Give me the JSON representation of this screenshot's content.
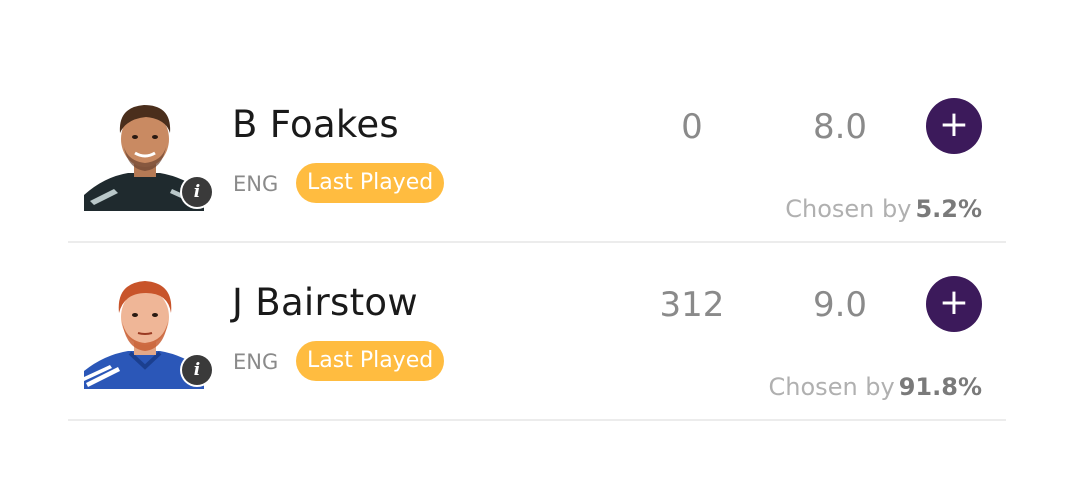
{
  "players": [
    {
      "name": "B Foakes",
      "team": "ENG",
      "badge": "Last Played",
      "points": "0",
      "credits": "8.0",
      "add_label": "+",
      "chosen_label": "Chosen by",
      "chosen_pct": "5.2%",
      "info_label": "i",
      "avatar": "player-headshot"
    },
    {
      "name": "J Bairstow",
      "team": "ENG",
      "badge": "Last Played",
      "points": "312",
      "credits": "9.0",
      "add_label": "+",
      "chosen_label": "Chosen by",
      "chosen_pct": "91.8%",
      "info_label": "i",
      "avatar": "player-headshot"
    }
  ],
  "colors": {
    "accent": "#3c1a5b",
    "badge": "#ffbc40",
    "muted_text": "#8a8a8a",
    "divider": "#ececec"
  }
}
